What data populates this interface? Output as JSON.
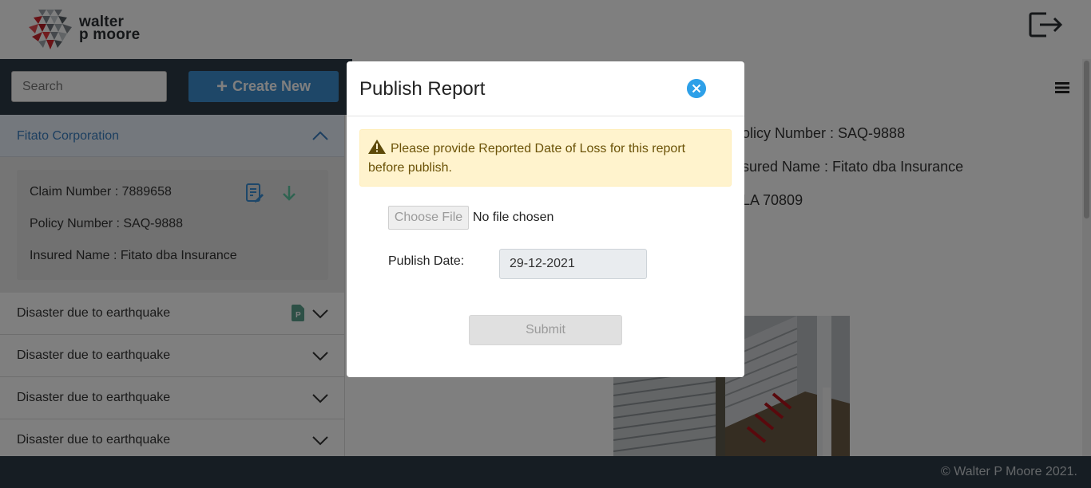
{
  "header": {
    "logo_text_line1": "walter",
    "logo_text_line2": "p moore",
    "logout_icon": "logout-icon"
  },
  "sidebar": {
    "search_placeholder": "Search",
    "create_new_label": "Create New",
    "company": "Fitato Corporation",
    "claim": {
      "claim_number": "Claim Number : 7889658",
      "policy_number": "Policy Number : SAQ-9888",
      "insured_name": "Insured Name : Fitato dba Insurance"
    },
    "items": [
      {
        "label": "Disaster due to earthquake",
        "has_doc_icon": true
      },
      {
        "label": "Disaster due to earthquake",
        "has_doc_icon": false
      },
      {
        "label": "Disaster due to earthquake",
        "has_doc_icon": false
      },
      {
        "label": "Disaster due to earthquake",
        "has_doc_icon": false
      }
    ]
  },
  "main": {
    "policy_line": "olicy Number : SAQ-9888",
    "insured_line": "sured Name : Fitato dba Insurance",
    "address_line": "LA 70809"
  },
  "modal": {
    "title": "Publish Report",
    "alert_text": "Please provide Reported Date of Loss for this report before publish.",
    "choose_file_label": "Choose File",
    "no_file_text": "No file chosen",
    "publish_date_label": "Publish Date:",
    "publish_date_value": "29-12-2021",
    "submit_label": "Submit"
  },
  "footer": {
    "text": "© Walter P Moore 2021."
  },
  "colors": {
    "accent": "#3d8fd1",
    "dark_nav": "#2d3a46",
    "alert_bg": "#fff3cd",
    "close_blue": "#2ea0e8"
  }
}
